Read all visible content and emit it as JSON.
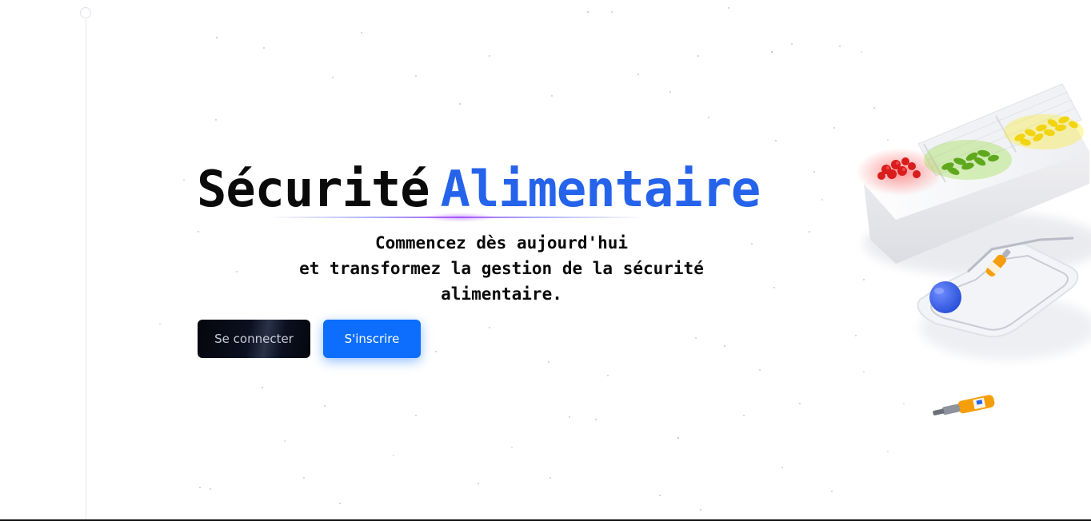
{
  "hero": {
    "title_black": "Sécurité",
    "title_blue": "Alimentaire",
    "subtitle_line1": "Commencez dès aujourd'hui",
    "subtitle_line2": "et transformez la gestion de la sécurité",
    "subtitle_line3": "alimentaire."
  },
  "actions": {
    "login_label": "Se connecter",
    "signup_label": "S'inscrire"
  },
  "colors": {
    "accent_blue": "#2563eb",
    "signup_button": "#0d6efd",
    "login_button": "#0b1020"
  },
  "illustration": {
    "icon": "food-display-3d-icon"
  }
}
